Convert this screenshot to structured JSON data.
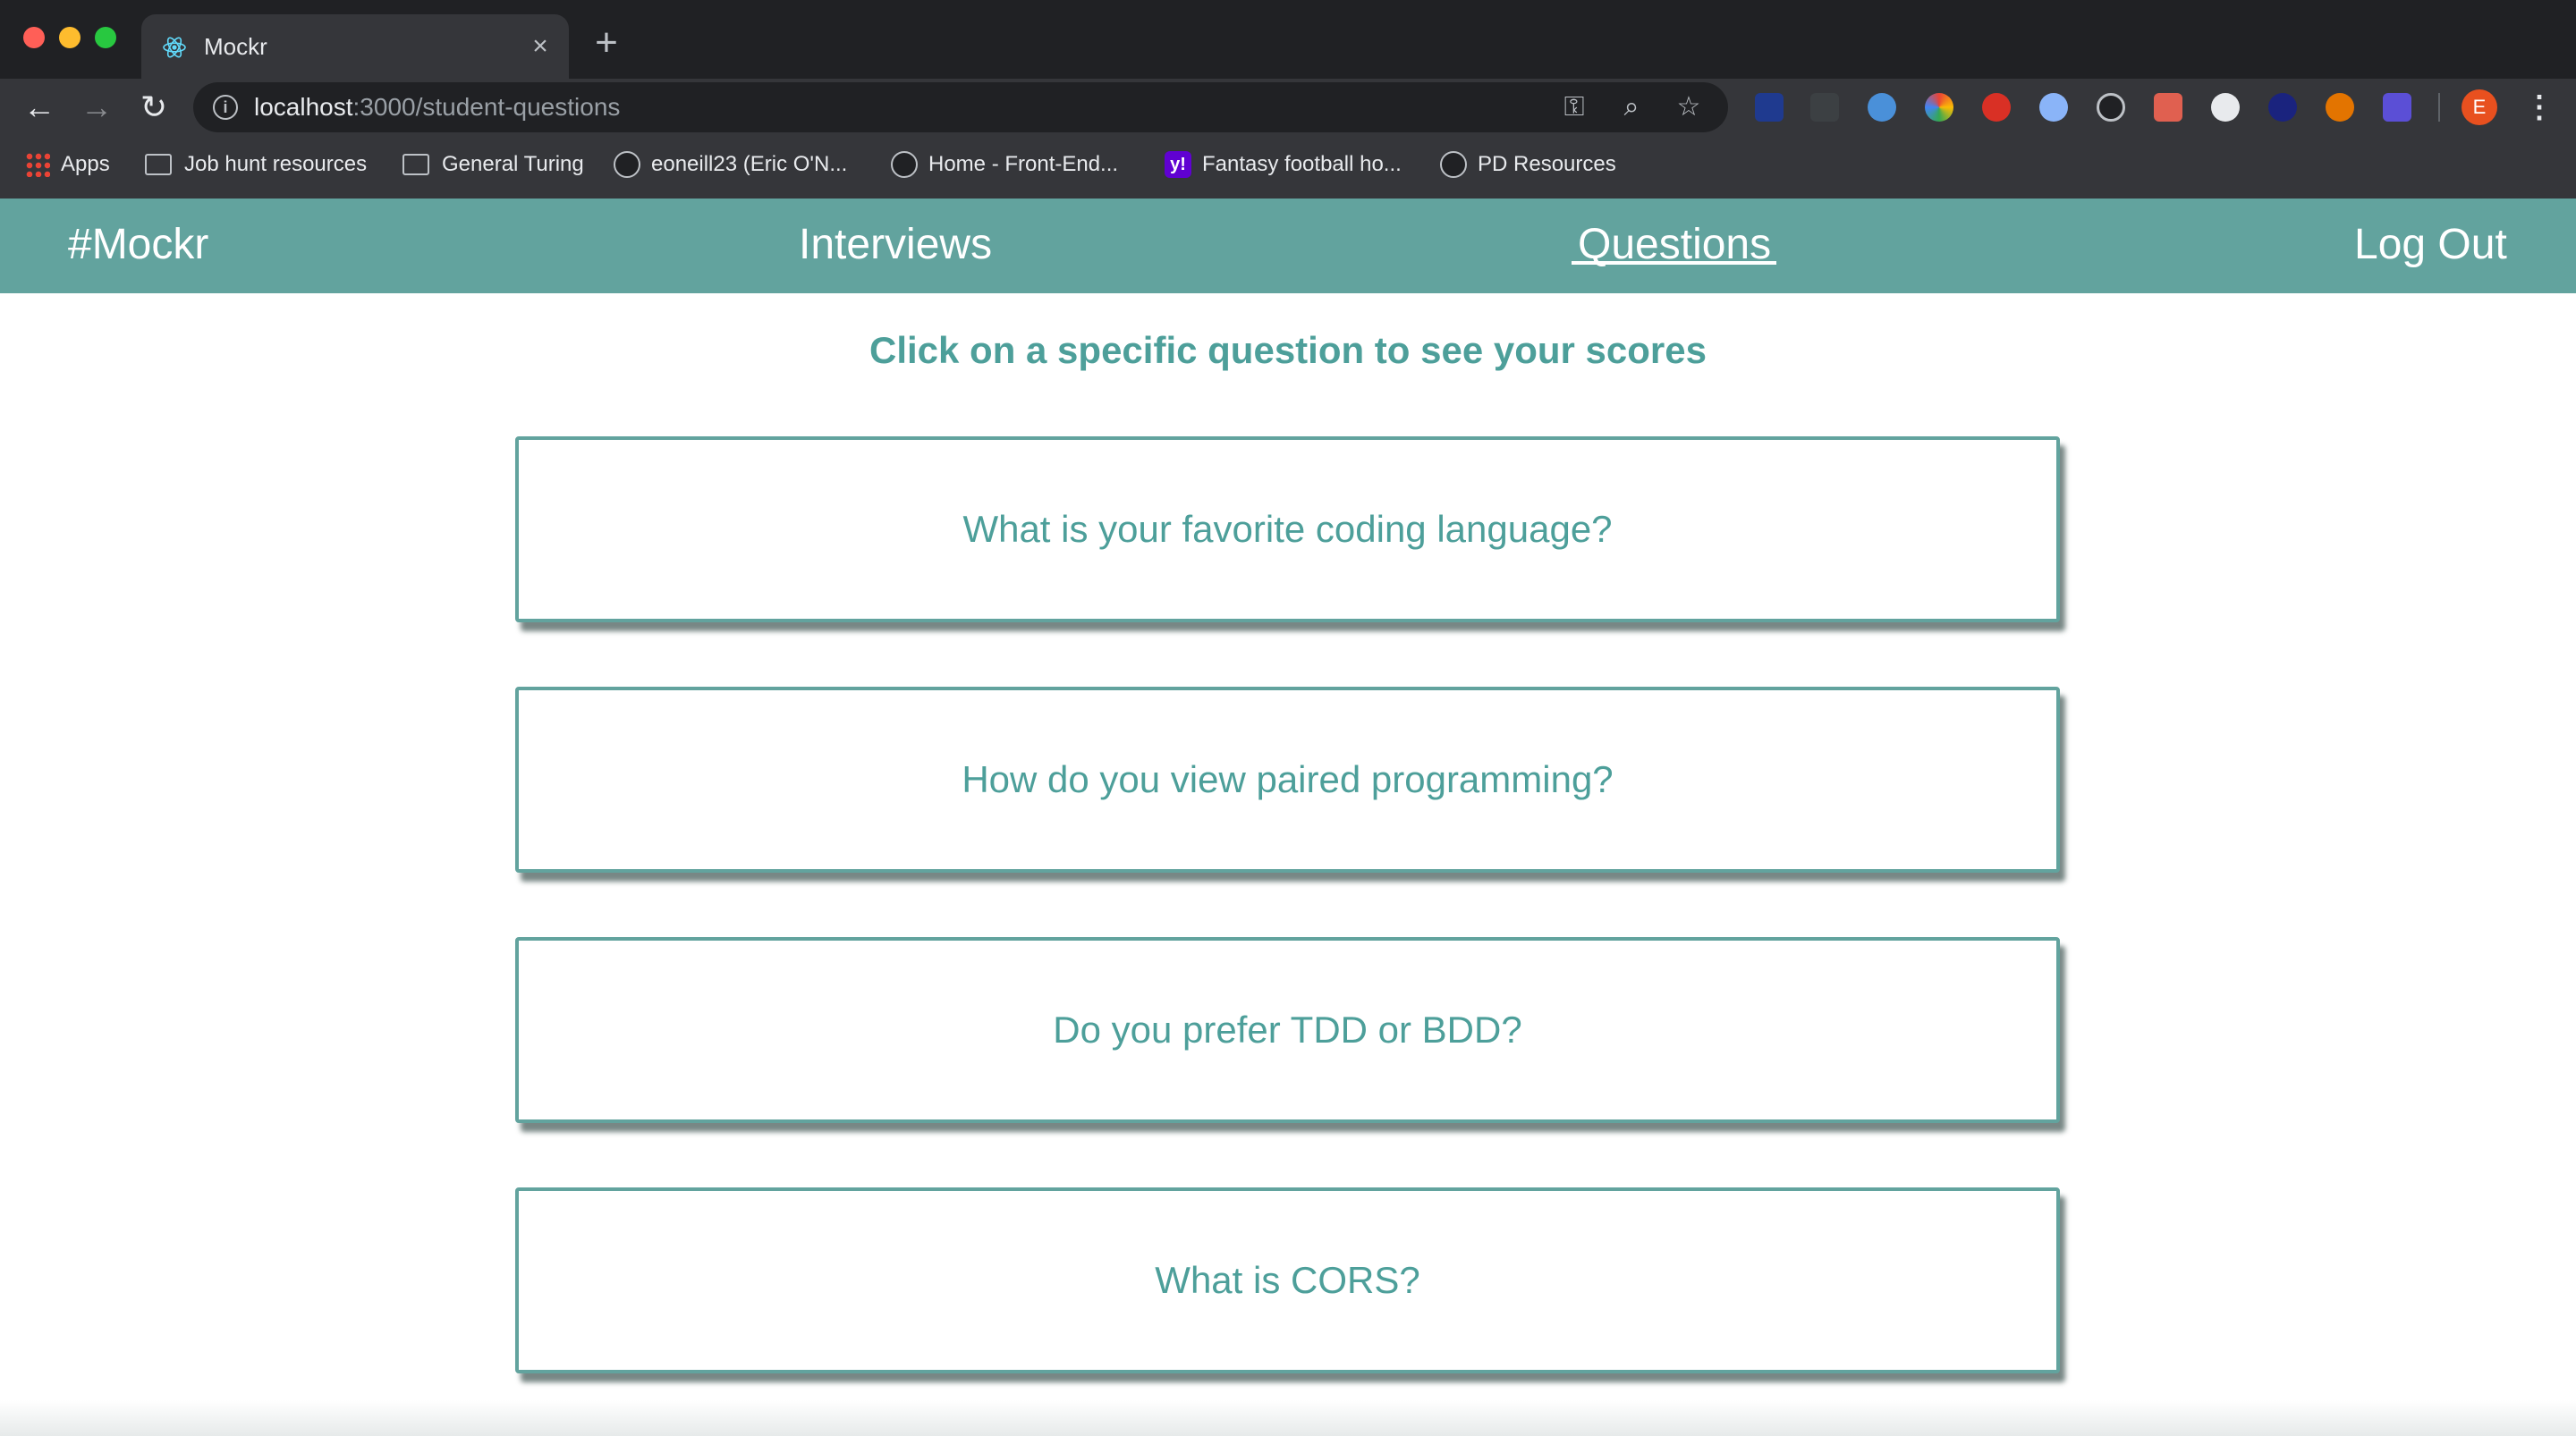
{
  "browser": {
    "tab_title": "Mockr",
    "url_host": "localhost",
    "url_path": ":3000/student-questions",
    "bookmarks": [
      {
        "label": "Apps",
        "icon": "apps-grid-icon"
      },
      {
        "label": "Job hunt resources",
        "icon": "folder-icon"
      },
      {
        "label": "General Turing",
        "icon": "folder-icon"
      },
      {
        "label": "eoneill23 (Eric O'N...",
        "icon": "github-icon"
      },
      {
        "label": "Home - Front-End...",
        "icon": "turing-icon"
      },
      {
        "label": "Fantasy football ho...",
        "icon": "yahoo-icon"
      },
      {
        "label": "PD Resources",
        "icon": "github-icon"
      }
    ],
    "avatar_initial": "E",
    "icons": {
      "close": "×",
      "new_tab": "+",
      "back": "←",
      "forward": "→",
      "reload": "↻",
      "info": "i",
      "key": "⚿",
      "zoom": "⌕",
      "star": "☆",
      "menu": "⋮",
      "yahoo": "y!"
    }
  },
  "nav": {
    "brand": "#Mockr",
    "interviews": "Interviews",
    "questions": "Questions",
    "logout": "Log Out"
  },
  "page": {
    "subtitle": "Click on a specific question to see your scores",
    "questions": [
      "What is your favorite coding language?",
      "How do you view paired programming?",
      "Do you prefer TDD or BDD?",
      "What is CORS?"
    ]
  },
  "colors": {
    "nav_background": "#62a39e",
    "accent_text": "#4d9f9a",
    "chrome_dark": "#202124",
    "chrome_toolbar": "#35363a"
  }
}
